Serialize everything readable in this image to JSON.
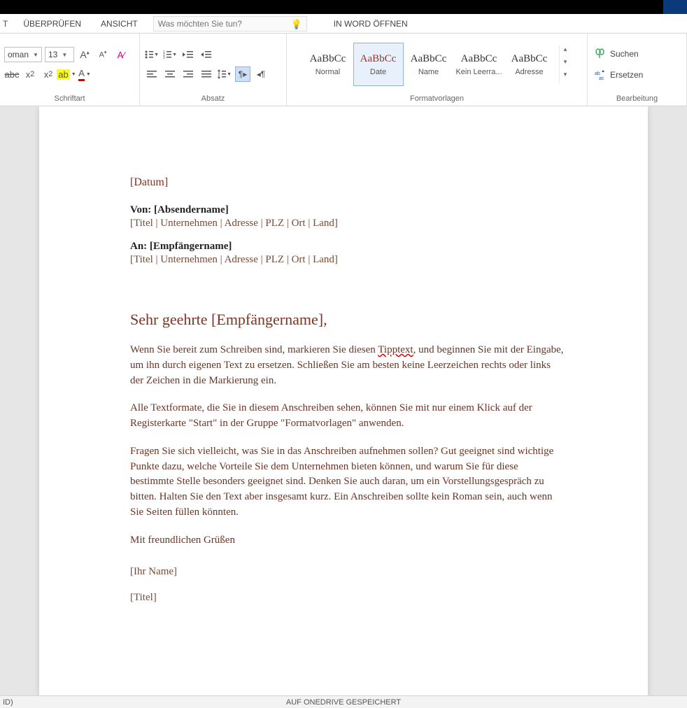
{
  "tabs": {
    "first": "T",
    "review": "ÜBERPRÜFEN",
    "view": "ANSICHT",
    "open_in_word": "IN WORD ÖFFNEN"
  },
  "tell_me": {
    "placeholder": "Was möchten Sie tun?"
  },
  "font": {
    "name": "oman",
    "size": "13",
    "group_label": "Schriftart"
  },
  "paragraph": {
    "group_label": "Absatz"
  },
  "styles": {
    "group_label": "Formatvorlagen",
    "items": [
      {
        "preview": "AaBbCc",
        "name": "Normal"
      },
      {
        "preview": "AaBbCc",
        "name": "Date"
      },
      {
        "preview": "AaBbCc",
        "name": "Name"
      },
      {
        "preview": "AaBbCc",
        "name": "Kein Leerra..."
      },
      {
        "preview": "AaBbCc",
        "name": "Adresse"
      }
    ]
  },
  "editing": {
    "group_label": "Bearbeitung",
    "find": "Suchen",
    "replace": "Ersetzen"
  },
  "document": {
    "date": "[Datum]",
    "from_label": "Von: [Absendername]",
    "from_sub": "[Titel | Unternehmen | Adresse | PLZ | Ort | Land]",
    "to_label": "An: [Empfängername]",
    "to_sub": "[Titel | Unternehmen | Adresse | PLZ | Ort | Land]",
    "salutation": "Sehr geehrte [Empfängername],",
    "p1_a": "Wenn Sie bereit zum Schreiben sind, markieren Sie diesen ",
    "p1_tip": "Tipptext",
    "p1_b": ", und beginnen Sie mit der Eingabe, um ihn durch eigenen Text zu ersetzen. Schließen Sie am besten keine Leerzeichen rechts oder links der Zeichen in die Markierung ein.",
    "p2": "Alle Textformate, die Sie in diesem Anschreiben sehen, können Sie mit nur einem Klick auf der Registerkarte \"Start\" in der Gruppe \"Formatvorlagen\" anwenden.",
    "p3": "Fragen Sie sich vielleicht, was Sie in das Anschreiben aufnehmen sollen? Gut geeignet sind wichtige Punkte dazu, welche Vorteile Sie dem Unternehmen bieten können, und warum Sie für diese bestimmte Stelle besonders geeignet sind. Denken Sie auch daran, um ein Vorstellungsgespräch zu bitten. Halten Sie den Text aber insgesamt kurz. Ein Anschreiben sollte kein Roman sein, auch wenn Sie Seiten füllen könnten.",
    "closing": "Mit freundlichen Grüßen",
    "sig_name": "[Ihr Name]",
    "sig_title": "[Titel]"
  },
  "status": {
    "left": "ID)",
    "center": "AUF ONEDRIVE GESPEICHERT"
  }
}
